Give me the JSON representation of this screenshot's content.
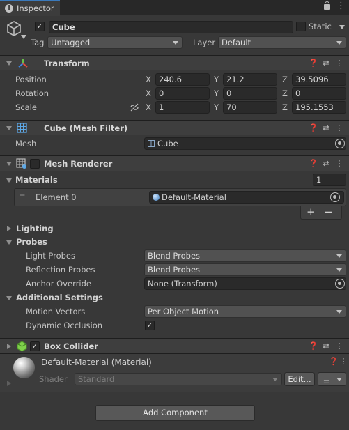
{
  "window": {
    "tab_title": "Inspector",
    "accent": "#3a79bb"
  },
  "object": {
    "name": "Cube",
    "static_label": "Static",
    "tag_label": "Tag",
    "tag_value": "Untagged",
    "layer_label": "Layer",
    "layer_value": "Default",
    "active": true,
    "static": false
  },
  "transform": {
    "title": "Transform",
    "position_label": "Position",
    "rotation_label": "Rotation",
    "scale_label": "Scale",
    "axis_x": "X",
    "axis_y": "Y",
    "axis_z": "Z",
    "position": {
      "x": "240.6",
      "y": "21.2",
      "z": "39.5096"
    },
    "rotation": {
      "x": "0",
      "y": "0",
      "z": "0"
    },
    "scale": {
      "x": "1",
      "y": "70",
      "z": "195.1553"
    }
  },
  "mesh_filter": {
    "title": "Cube (Mesh Filter)",
    "mesh_label": "Mesh",
    "mesh_value": "Cube"
  },
  "mesh_renderer": {
    "title": "Mesh Renderer",
    "materials_label": "Materials",
    "materials_count": "1",
    "element_label": "Element 0",
    "element_value": "Default-Material",
    "plus": "+",
    "minus": "−",
    "lighting_label": "Lighting",
    "probes_label": "Probes",
    "light_probes_label": "Light Probes",
    "light_probes_value": "Blend Probes",
    "reflection_probes_label": "Reflection Probes",
    "reflection_probes_value": "Blend Probes",
    "anchor_override_label": "Anchor Override",
    "anchor_override_value": "None (Transform)",
    "additional_label": "Additional Settings",
    "motion_vectors_label": "Motion Vectors",
    "motion_vectors_value": "Per Object Motion",
    "dynamic_occlusion_label": "Dynamic Occlusion",
    "dynamic_occlusion": true
  },
  "box_collider": {
    "title": "Box Collider",
    "enabled": true
  },
  "material": {
    "title": "Default-Material (Material)",
    "shader_label": "Shader",
    "shader_value": "Standard",
    "edit_label": "Edit..."
  },
  "add_component_label": "Add Component"
}
